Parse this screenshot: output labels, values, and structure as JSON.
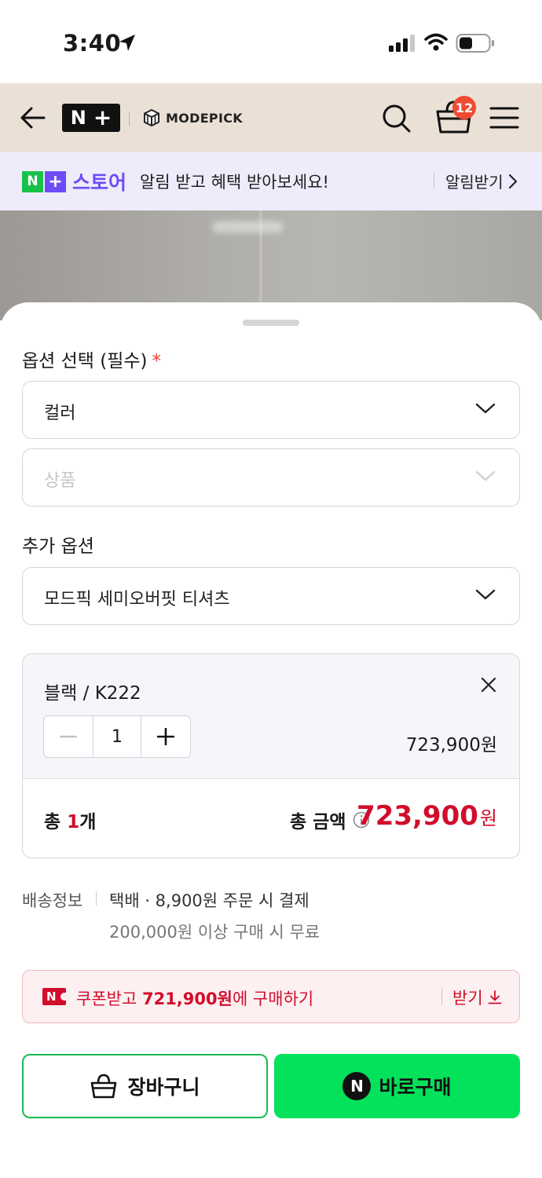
{
  "status_bar": {
    "time": "3:40"
  },
  "header": {
    "logo": "N+",
    "brand": "MODEPICK",
    "cart_count": "12"
  },
  "store_banner": {
    "store_name": "스토어",
    "message": "알림 받고 혜택 받아보세요!",
    "action": "알림받기"
  },
  "options": {
    "required_title": "옵션 선택 (필수)",
    "required_mark": "*",
    "color_select": "컬러",
    "product_select_placeholder": "상품",
    "additional_title": "추가 옵션",
    "additional_select": "모드픽 세미오버핏 티셔츠"
  },
  "selected_item": {
    "name": "블랙 / K222",
    "quantity": "1",
    "price": "723,900원"
  },
  "total": {
    "count_prefix": "총 ",
    "count_value": "1",
    "count_suffix": "개",
    "amount_label": "총 금액",
    "amount_value": "723,900",
    "amount_unit": "원"
  },
  "delivery": {
    "label": "배송정보",
    "info": "택배 · 8,900원 주문 시 결제",
    "free_condition": "200,000원 이상 구매 시 무료"
  },
  "coupon": {
    "text_prefix": "쿠폰받고 ",
    "price": "721,900원",
    "text_suffix": "에 구매하기",
    "action": "받기"
  },
  "buttons": {
    "cart": "장바구니",
    "buy": "바로구매"
  },
  "colors": {
    "header_bg": "#ebe0d6",
    "banner_bg": "#eeebfb",
    "accent_red": "#d10d2b",
    "naver_green": "#03e25a",
    "store_purple": "#6e4cf5"
  }
}
